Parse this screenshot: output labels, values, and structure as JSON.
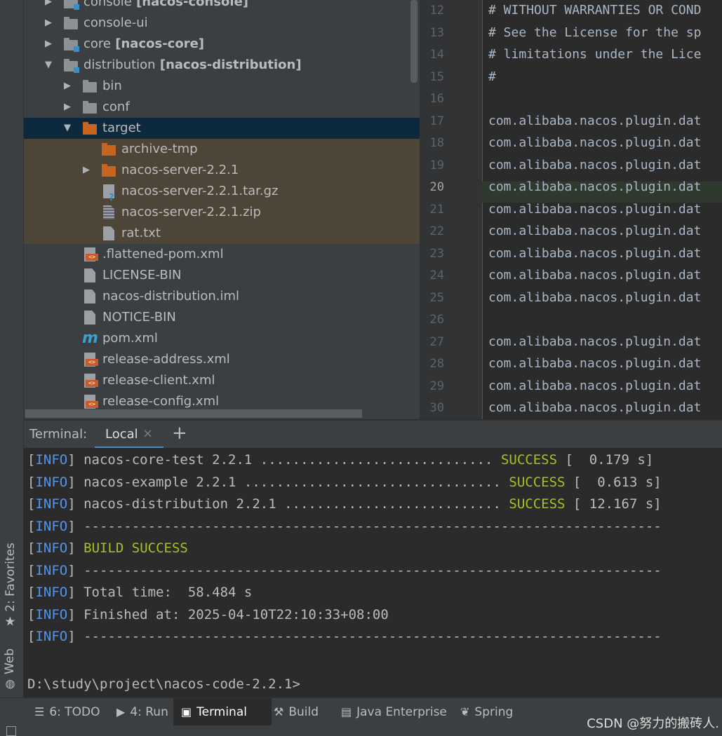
{
  "project_tree": {
    "rows": [
      {
        "name": "console",
        "module": "[nacos-console]",
        "expanded": false,
        "type": "module"
      },
      {
        "name": "console-ui",
        "expanded": false,
        "type": "folder"
      },
      {
        "name": "core",
        "module": "[nacos-core]",
        "expanded": false,
        "type": "module"
      },
      {
        "name": "distribution",
        "module": "[nacos-distribution]",
        "expanded": true,
        "type": "module"
      },
      {
        "name": "bin",
        "expanded": false,
        "type": "folder"
      },
      {
        "name": "conf",
        "expanded": false,
        "type": "folder"
      },
      {
        "name": "target",
        "expanded": true,
        "type": "folder-excluded",
        "selected": true
      },
      {
        "name": "archive-tmp",
        "type": "folder-excluded"
      },
      {
        "name": "nacos-server-2.2.1",
        "expanded": false,
        "type": "folder-excluded"
      },
      {
        "name": "nacos-server-2.2.1.tar.gz",
        "type": "file-unknown"
      },
      {
        "name": "nacos-server-2.2.1.zip",
        "type": "file-archive"
      },
      {
        "name": "rat.txt",
        "type": "file-text"
      },
      {
        "name": ".flattened-pom.xml",
        "type": "file-xml"
      },
      {
        "name": "LICENSE-BIN",
        "type": "file-text"
      },
      {
        "name": "nacos-distribution.iml",
        "type": "file-iml"
      },
      {
        "name": "NOTICE-BIN",
        "type": "file-text"
      },
      {
        "name": "pom.xml",
        "type": "file-maven"
      },
      {
        "name": "release-address.xml",
        "type": "file-xml"
      },
      {
        "name": "release-client.xml",
        "type": "file-xml"
      },
      {
        "name": "release-config.xml",
        "type": "file-xml"
      }
    ]
  },
  "editor": {
    "current_line": "20",
    "lines": [
      {
        "num": "12",
        "text": "# WITHOUT WARRANTIES OR COND",
        "kind": "comment"
      },
      {
        "num": "13",
        "text": "# See the License for the sp",
        "kind": "comment"
      },
      {
        "num": "14",
        "text": "# limitations under the Lice",
        "kind": "comment"
      },
      {
        "num": "15",
        "text": "#",
        "kind": "comment"
      },
      {
        "num": "16",
        "text": "",
        "kind": "code"
      },
      {
        "num": "17",
        "text": "com.alibaba.nacos.plugin.dat",
        "kind": "code"
      },
      {
        "num": "18",
        "text": "com.alibaba.nacos.plugin.dat",
        "kind": "code"
      },
      {
        "num": "19",
        "text": "com.alibaba.nacos.plugin.dat",
        "kind": "code"
      },
      {
        "num": "20",
        "text": "com.alibaba.nacos.plugin.dat",
        "kind": "code"
      },
      {
        "num": "21",
        "text": "com.alibaba.nacos.plugin.dat",
        "kind": "code"
      },
      {
        "num": "22",
        "text": "com.alibaba.nacos.plugin.dat",
        "kind": "code"
      },
      {
        "num": "23",
        "text": "com.alibaba.nacos.plugin.dat",
        "kind": "code"
      },
      {
        "num": "24",
        "text": "com.alibaba.nacos.plugin.dat",
        "kind": "code"
      },
      {
        "num": "25",
        "text": "com.alibaba.nacos.plugin.dat",
        "kind": "code"
      },
      {
        "num": "26",
        "text": "",
        "kind": "code"
      },
      {
        "num": "27",
        "text": "com.alibaba.nacos.plugin.dat",
        "kind": "code"
      },
      {
        "num": "28",
        "text": "com.alibaba.nacos.plugin.dat",
        "kind": "code"
      },
      {
        "num": "29",
        "text": "com.alibaba.nacos.plugin.dat",
        "kind": "code"
      },
      {
        "num": "30",
        "text": "com.alibaba.nacos.plugin.dat",
        "kind": "code"
      }
    ]
  },
  "terminal": {
    "header_label": "Terminal:",
    "tab_label": "Local",
    "close_glyph": "×",
    "add_glyph": "+",
    "lines": [
      {
        "tag": "[INFO]",
        "text": " nacos-core-test 2.2.1 ............................. ",
        "status": "SUCCESS",
        "suffix": " [  0.179 s]"
      },
      {
        "tag": "[INFO]",
        "text": " nacos-example 2.2.1 ................................ ",
        "status": "SUCCESS",
        "suffix": " [  0.613 s]"
      },
      {
        "tag": "[INFO]",
        "text": " nacos-distribution 2.2.1 ........................... ",
        "status": "SUCCESS",
        "suffix": " [ 12.167 s]"
      },
      {
        "tag": "[INFO]",
        "text": " ------------------------------------------------------------------------",
        "status": "",
        "suffix": ""
      },
      {
        "tag": "[INFO]",
        "text": " ",
        "status": "BUILD SUCCESS",
        "suffix": ""
      },
      {
        "tag": "[INFO]",
        "text": " ------------------------------------------------------------------------",
        "status": "",
        "suffix": ""
      },
      {
        "tag": "[INFO]",
        "text": " Total time:  58.484 s",
        "status": "",
        "suffix": ""
      },
      {
        "tag": "[INFO]",
        "text": " Finished at: 2025-04-10T22:10:33+08:00",
        "status": "",
        "suffix": ""
      },
      {
        "tag": "[INFO]",
        "text": " ------------------------------------------------------------------------",
        "status": "",
        "suffix": ""
      }
    ],
    "prompt": "D:\\study\\project\\nacos-code-2.2.1>"
  },
  "side_tabs": {
    "favorites": "2: Favorites",
    "web": "Web"
  },
  "bottom_tabs": [
    {
      "label": "6: TODO",
      "icon": "list-icon"
    },
    {
      "label": "4: Run",
      "icon": "play-icon"
    },
    {
      "label": "Terminal",
      "icon": "terminal-icon",
      "active": true
    },
    {
      "label": "Build",
      "icon": "hammer-icon"
    },
    {
      "label": "Java Enterprise",
      "icon": "java-enterprise-icon"
    },
    {
      "label": "Spring",
      "icon": "spring-leaf-icon"
    }
  ],
  "watermark": "CSDN @努力的搬砖人."
}
